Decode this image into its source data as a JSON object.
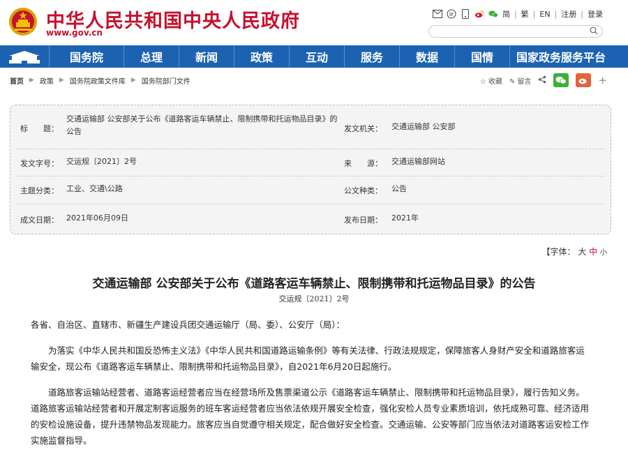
{
  "header": {
    "site_title": "中华人民共和国中央人民政府",
    "site_domain": "www.gov.cn",
    "lang_links": [
      "简",
      "繁",
      "EN"
    ],
    "register": "注册",
    "login": "登录",
    "search_placeholder": ""
  },
  "nav": {
    "items": [
      "国务院",
      "总理",
      "新闻",
      "政策",
      "互动",
      "服务",
      "数据",
      "国情",
      "国家政务服务平台"
    ]
  },
  "breadcrumb": [
    "首页",
    "政策",
    "国务院政策文件库",
    "国务院部门文件"
  ],
  "tools": {
    "favorite": "收藏",
    "comment": "留言",
    "plus": "+"
  },
  "meta": {
    "title_label": "标　　题：",
    "title_value": "交通运输部 公安部关于公布《道路客运车辆禁止、限制携带和托运物品目录》的公告",
    "issuer_label": "发文机关：",
    "issuer_value": "交通运输部 公安部",
    "docno_label": "发文字号：",
    "docno_value": "交运规〔2021〕2号",
    "source_label": "来　　源：",
    "source_value": "交通运输部网站",
    "topic_label": "主题分类：",
    "topic_value": "工业、交通\\公路",
    "type_label": "公文种类：",
    "type_value": "公告",
    "date_label": "成文日期：",
    "date_value": "2021年06月09日",
    "pubdate_label": "发布日期：",
    "pubdate_value": "2021年"
  },
  "fontsize": {
    "prefix": "【字体：",
    "large": "大",
    "medium": "中",
    "small": "小"
  },
  "document": {
    "title": "交通运输部 公安部关于公布《道路客运车辆禁止、限制携带和托运物品目录》的公告",
    "number": "交运规〔2021〕2号",
    "salutation": "各省、自治区、直辖市、新疆生产建设兵团交通运输厅（局、委）、公安厅（局）：",
    "p1": "为落实《中华人民共和国反恐怖主义法》《中华人民共和国道路运输条例》等有关法律、行政法规规定，保障旅客人身财产安全和道路旅客运输安全，现公布《道路客运车辆禁止、限制携带和托运物品目录》，自2021年6月20日起施行。",
    "p2": "道路旅客运输站经营者、道路客运经营者应当在经营场所及售票渠道公示《道路客运车辆禁止、限制携带和托运物品目录》，履行告知义务。道路旅客运输站经营者和开展定制客运服务的班车客运经营者应当依法依规开展安全检查，强化安检人员专业素质培训，依托成熟可靠、经济适用的安检设施设备，提升违禁物品发现能力。旅客应当自觉遵守相关规定，配合做好安全检查。交通运输、公安等部门应当依法对道路客运安检工作实施监督指导。"
  }
}
